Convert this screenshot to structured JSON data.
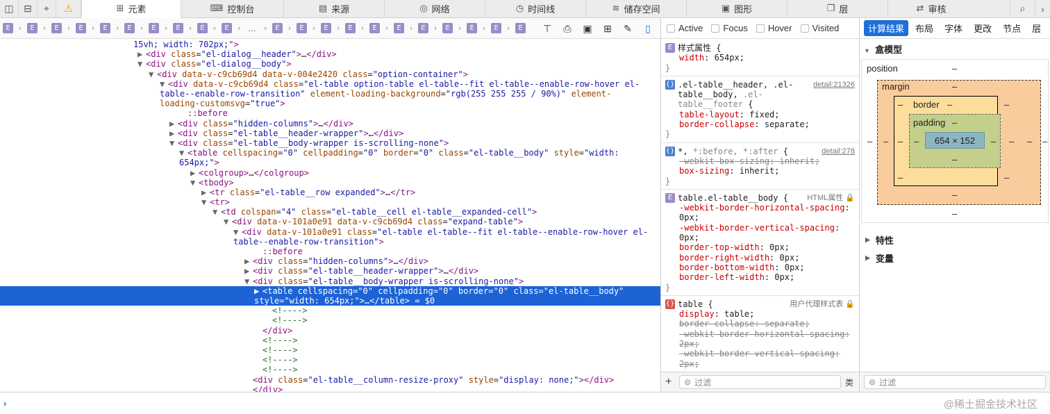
{
  "topbar": {
    "tabs": [
      {
        "icon": "elements-icon",
        "glyph": "⊞",
        "label": "元素",
        "active": true
      },
      {
        "icon": "console-icon",
        "glyph": "⌨",
        "label": "控制台"
      },
      {
        "icon": "sources-icon",
        "glyph": "▤",
        "label": "来源"
      },
      {
        "icon": "network-icon",
        "glyph": "◎",
        "label": "网络"
      },
      {
        "icon": "timeline-icon",
        "glyph": "◷",
        "label": "时间线"
      },
      {
        "icon": "storage-icon",
        "glyph": "≋",
        "label": "储存空间"
      },
      {
        "icon": "graphics-icon",
        "glyph": "▣",
        "label": "图形"
      },
      {
        "icon": "layers-icon",
        "glyph": "❐",
        "label": "层"
      },
      {
        "icon": "audit-icon",
        "glyph": "⇄",
        "label": "审核"
      }
    ]
  },
  "breadcrumbs": {
    "badge": "E",
    "ellipsis": "…"
  },
  "tree": {
    "lines": [
      {
        "indent": 192,
        "html": "<span class='val'>15vh; width: 702px;</span><span class='tag'>\"&gt;</span>"
      },
      {
        "indent": 210,
        "html": "<span class='arrow'>▶</span><span class='tag'>&lt;div</span> <span class='attr'>class</span>=<span class='val'>\"el-dialog__header\"</span><span class='tag'>&gt;</span>…<span class='tag'>&lt;/div&gt;</span>"
      },
      {
        "indent": 210,
        "html": "<span class='arrow'>▼</span><span class='tag'>&lt;div</span> <span class='attr'>class</span>=<span class='val'>\"el-dialog__body\"</span><span class='tag'>&gt;</span>"
      },
      {
        "indent": 226,
        "html": "<span class='arrow'>▼</span><span class='tag'>&lt;div</span> <span class='attr'>data-v-c9cb69d4 data-v-004e2420 class</span>=<span class='val'>\"option-container\"</span><span class='tag'>&gt;</span>"
      },
      {
        "indent": 242,
        "wrap": true,
        "html": "<span class='arrow'>▼</span><span class='tag'>&lt;div</span> <span class='attr'>data-v-c9cb69d4 class</span>=<span class='val'>\"el-table option-table el-table--fit el-table--enable-row-hover el-table--enable-row-transition\"</span> <span class='attr'>element-loading-background</span>=<span class='val'>\"rgb(255 255 255 / 90%)\"</span> <span class='attr'>element-loading-customsvg</span>=<span class='val'>\"true\"</span><span class='tag'>&gt;</span>"
      },
      {
        "indent": 270,
        "html": "<span class='pseudo'>::before</span>"
      },
      {
        "indent": 256,
        "html": "<span class='arrow'>▶</span><span class='tag'>&lt;div</span> <span class='attr'>class</span>=<span class='val'>\"hidden-columns\"</span><span class='tag'>&gt;</span>…<span class='tag'>&lt;/div&gt;</span>"
      },
      {
        "indent": 256,
        "html": "<span class='arrow'>▶</span><span class='tag'>&lt;div</span> <span class='attr'>class</span>=<span class='val'>\"el-table__header-wrapper\"</span><span class='tag'>&gt;</span>…<span class='tag'>&lt;/div&gt;</span>"
      },
      {
        "indent": 256,
        "html": "<span class='arrow'>▼</span><span class='tag'>&lt;div</span> <span class='attr'>class</span>=<span class='val'>\"el-table__body-wrapper is-scrolling-none\"</span><span class='tag'>&gt;</span>"
      },
      {
        "indent": 270,
        "wrap": true,
        "html": "<span class='arrow'>▼</span><span class='tag'>&lt;table</span> <span class='attr'>cellspacing</span>=<span class='val'>\"0\"</span> <span class='attr'>cellpadding</span>=<span class='val'>\"0\"</span> <span class='attr'>border</span>=<span class='val'>\"0\"</span> <span class='attr'>class</span>=<span class='val'>\"el-table__body\"</span> <span class='attr'>style</span>=<span class='val'>\"width: 654px;\"</span><span class='tag'>&gt;</span>"
      },
      {
        "indent": 286,
        "html": "<span class='arrow'>▶</span><span class='tag'>&lt;colgroup&gt;</span>…<span class='tag'>&lt;/colgroup&gt;</span>"
      },
      {
        "indent": 286,
        "html": "<span class='arrow'>▼</span><span class='tag'>&lt;tbody&gt;</span>"
      },
      {
        "indent": 302,
        "html": "<span class='arrow'>▶</span><span class='tag'>&lt;tr</span> <span class='attr'>class</span>=<span class='val'>\"el-table__row expanded\"</span><span class='tag'>&gt;</span>…<span class='tag'>&lt;/tr&gt;</span>"
      },
      {
        "indent": 302,
        "html": "<span class='arrow'>▼</span><span class='tag'>&lt;tr&gt;</span>"
      },
      {
        "indent": 318,
        "html": "<span class='arrow'>▼</span><span class='tag'>&lt;td</span> <span class='attr'>colspan</span>=<span class='val'>\"4\"</span> <span class='attr'>class</span>=<span class='val'>\"el-table__cell el-table__expanded-cell\"</span><span class='tag'>&gt;</span>"
      },
      {
        "indent": 334,
        "html": "<span class='arrow'>▼</span><span class='tag'>&lt;div</span> <span class='attr'>data-v-101a0e91 data-v-c9cb69d4 class</span>=<span class='val'>\"expand-table\"</span><span class='tag'>&gt;</span>"
      },
      {
        "indent": 348,
        "wrap": true,
        "html": "<span class='arrow'>▼</span><span class='tag'>&lt;div</span> <span class='attr'>data-v-101a0e91 class</span>=<span class='val'>\"el-table el-table--fit el-table--enable-row-hover el-table--enable-row-transition\"</span><span class='tag'>&gt;</span>"
      },
      {
        "indent": 378,
        "html": "<span class='pseudo'>::before</span>"
      },
      {
        "indent": 364,
        "html": "<span class='arrow'>▶</span><span class='tag'>&lt;div</span> <span class='attr'>class</span>=<span class='val'>\"hidden-columns\"</span><span class='tag'>&gt;</span>…<span class='tag'>&lt;/div&gt;</span>"
      },
      {
        "indent": 364,
        "html": "<span class='arrow'>▶</span><span class='tag'>&lt;div</span> <span class='attr'>class</span>=<span class='val'>\"el-table__header-wrapper\"</span><span class='tag'>&gt;</span>…<span class='tag'>&lt;/div&gt;</span>"
      },
      {
        "indent": 364,
        "html": "<span class='arrow'>▼</span><span class='tag'>&lt;div</span> <span class='attr'>class</span>=<span class='val'>\"el-table__body-wrapper is-scrolling-none\"</span><span class='tag'>&gt;</span>"
      },
      {
        "indent": 378,
        "wrap": true,
        "sel": true,
        "html": "<span class='arrow'>▶</span><span class='tag'>&lt;table</span> <span class='attr'>cellspacing</span>=<span class='val'>\"0\"</span> <span class='attr'>cellpadding</span>=<span class='val'>\"0\"</span> <span class='attr'>border</span>=<span class='val'>\"0\"</span> <span class='attr'>class</span>=<span class='val'>\"el-table__body\"</span> <span class='attr'>style</span>=<span class='val'>\"width: 654px;\"</span><span class='tag'>&gt;</span>…<span class='tag'>&lt;/table&gt;</span> = $0"
      },
      {
        "indent": 392,
        "html": "<span class='cm'>&lt;!----&gt;</span>"
      },
      {
        "indent": 392,
        "html": "<span class='cm'>&lt;!----&gt;</span>"
      },
      {
        "indent": 378,
        "html": "<span class='tag'>&lt;/div&gt;</span>"
      },
      {
        "indent": 378,
        "html": "<span class='cm'>&lt;!----&gt;</span>"
      },
      {
        "indent": 378,
        "html": "<span class='cm'>&lt;!----&gt;</span>"
      },
      {
        "indent": 378,
        "html": "<span class='cm'>&lt;!----&gt;</span>"
      },
      {
        "indent": 378,
        "html": "<span class='cm'>&lt;!----&gt;</span>"
      },
      {
        "indent": 364,
        "html": "<span class='tag'>&lt;div</span> <span class='attr'>class</span>=<span class='val'>\"el-table__column-resize-proxy\"</span> <span class='attr'>style</span>=<span class='val'>\"display: none;\"</span><span class='tag'>&gt;&lt;/div&gt;</span>"
      },
      {
        "indent": 364,
        "html": "<span class='tag'>&lt;/div&gt;</span>"
      }
    ]
  },
  "states": [
    "Active",
    "Focus",
    "Hover",
    "Visited"
  ],
  "computed_tabs": [
    "计算结果",
    "布局",
    "字体",
    "更改",
    "节点",
    "层"
  ],
  "rules": {
    "r1_selector": "样式属性 {",
    "r1_decl": "width: 654px;",
    "r2_selector": ".el-table__header, .el-table__body, .el-table__footer {",
    "r2_src": "detail:21326",
    "r3_selector": "*, *:before, *:after {",
    "r3_src": "detail:278",
    "r4_selector": "table.el-table__body {",
    "r4_src": "HTML属性 🔒",
    "r5_selector": "table {",
    "r5_src": "用户代理样式表 🔒"
  },
  "filter_placeholder": "过滤",
  "class_toggle": "类",
  "boxmodel": {
    "title": "盒模型",
    "position": "position",
    "margin": "margin",
    "border": "border",
    "padding": "padding",
    "content": "654 × 152",
    "dash": "–"
  },
  "sections": {
    "props": "特性",
    "vars": "变量"
  },
  "console": {
    "prompt": "›"
  },
  "watermark": "@稀土掘金技术社区",
  "colors": {
    "accent": "#1e6fd9",
    "selection": "#1d63d6",
    "warning": "#e8a400"
  }
}
